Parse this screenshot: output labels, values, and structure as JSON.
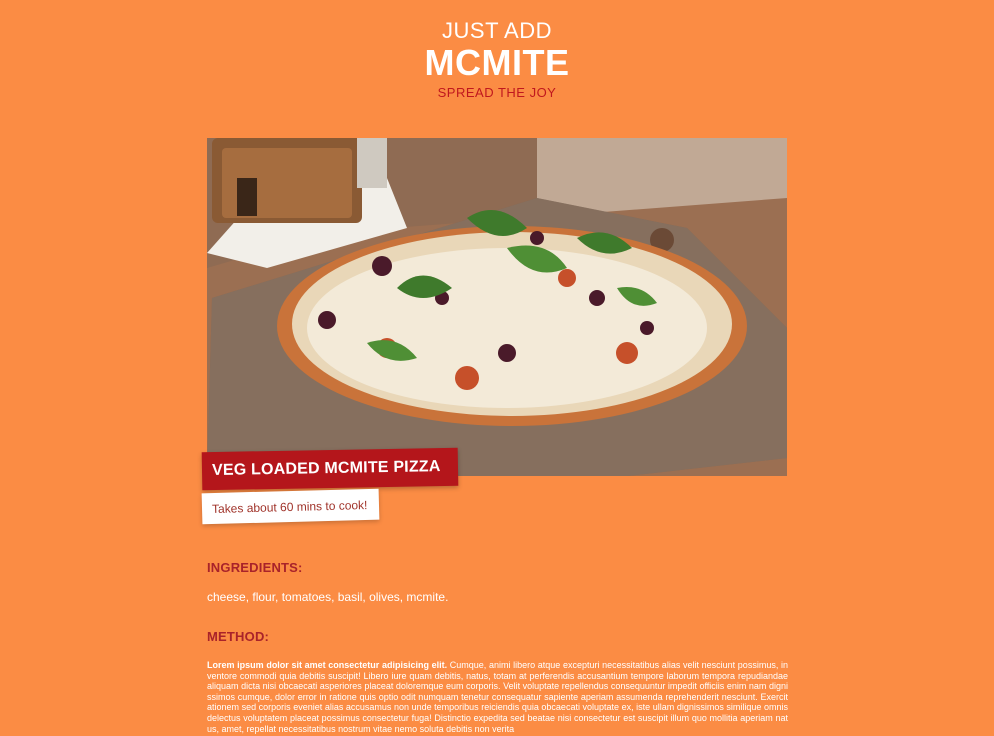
{
  "header": {
    "pre_title": "JUST ADD",
    "brand": "MCMITE",
    "tagline": "SPREAD THE JOY"
  },
  "recipe": {
    "image_alt": "pizza on a wooden board",
    "title": "VEG LOADED MCMITE PIZZA",
    "time": "Takes about 60 mins to cook!",
    "ingredients_heading": "INGREDIENTS:",
    "ingredients": "cheese, flour, tomatoes, basil, olives, mcmite.",
    "method_heading": "METHOD:",
    "method_lead": "Lorem ipsum dolor sit amet consectetur adipisicing elit.",
    "method_body": "Cumque, animi libero atque excepturi necessitatibus alias velit nesciunt possimus, inventore commodi quia debitis suscipit! Libero iure quam debitis, natus, totam at perferendis accusantium tempore laborum tempora repudiandae aliquam dicta nisi obcaecati asperiores placeat doloremque eum corporis. Velit voluptate repellendus consequuntur impedit officiis enim nam dignissimos cumque, dolor error in ratione quis optio odit numquam tenetur consequatur sapiente aperiam assumenda reprehenderit nesciunt. Exercitationem sed corporis eveniet alias accusamus non unde temporibus reiciendis quia obcaecati voluptate ex, iste ullam dignissimos similique omnis delectus voluptatem placeat possimus consectetur fuga! Distinctio expedita sed beatae nisi consectetur est suscipit illum quo mollitia aperiam natus, amet, repellat necessitatibus nostrum vitae nemo soluta debitis non verita"
  },
  "colors": {
    "background": "#fb8c44",
    "accent_red": "#b4161b",
    "heading_red": "#a9232a",
    "white": "#ffffff"
  }
}
